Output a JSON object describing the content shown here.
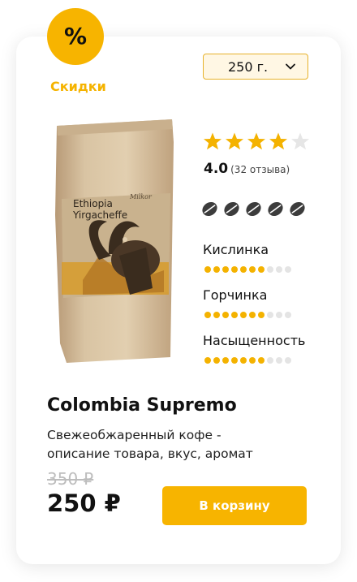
{
  "badge": {
    "symbol": "%",
    "label": "Скидки"
  },
  "weight_select": {
    "value": "250 г."
  },
  "product": {
    "image_text": {
      "line1": "Ethiopia",
      "line2": "Yirgacheffe",
      "brand": "Milkor"
    },
    "rating": {
      "stars_filled": 4,
      "stars_total": 5,
      "value": "4.0",
      "reviews": "(32 отзыва)"
    },
    "roast": {
      "beans": 5
    },
    "params": [
      {
        "label": "Кислинка",
        "level": 7,
        "max": 10
      },
      {
        "label": "Горчинка",
        "level": 7,
        "max": 10
      },
      {
        "label": "Насыщенность",
        "level": 7,
        "max": 10
      }
    ],
    "title": "Colombia Supremo",
    "description": "Свежеобжаренный кофе - описание товара, вкус, аромат",
    "old_price": "350 ₽",
    "price": "250 ₽",
    "cart_label": "В корзину"
  },
  "colors": {
    "accent": "#F7B400",
    "star": "#F4B200",
    "star_empty": "#E6E6E6",
    "dot_empty": "#E4E4E4",
    "bean": "#3C3C3C"
  },
  "icons": {
    "select": "chevron-down-icon",
    "star": "star-icon",
    "roast": "coffee-bean-icon"
  }
}
